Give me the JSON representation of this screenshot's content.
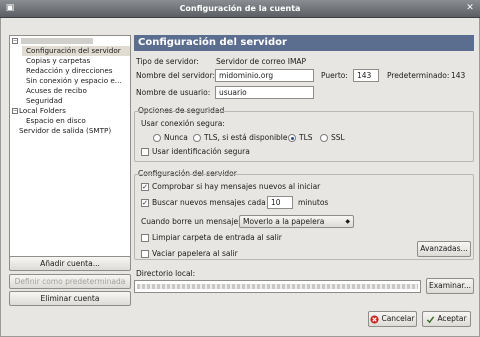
{
  "window": {
    "title": "Configuración de la cuenta"
  },
  "tree": {
    "account_blurred": true,
    "items": [
      "Configuración del servidor",
      "Copias y carpetas",
      "Redacción y direcciones",
      "Sin conexión y espacio e...",
      "Acuses de recibo",
      "Seguridad"
    ],
    "local_folders": "Local Folders",
    "disk_space": "Espacio en disco",
    "smtp": "Servidor de salida (SMTP)"
  },
  "left_buttons": {
    "add_account": "Añadir cuenta...",
    "set_default": "Definir como predeterminada",
    "delete_account": "Eliminar cuenta"
  },
  "panel": {
    "header": "Configuración del servidor",
    "server_type_label": "Tipo de servidor:",
    "server_type_value": "Servidor de correo IMAP",
    "server_name_label": "Nombre del servidor:",
    "server_name_value": "midominio.org",
    "port_label": "Puerto:",
    "port_value": "143",
    "default_label": "Predeterminado:",
    "default_value": "143",
    "username_label": "Nombre de usuario:",
    "username_value": "usuario"
  },
  "security": {
    "legend": "Opciones de seguridad",
    "secure_conn_label": "Usar conexión segura:",
    "options": [
      "Nunca",
      "TLS, si está disponible",
      "TLS",
      "SSL"
    ],
    "selected": "TLS",
    "secure_auth": "Usar identificación segura",
    "secure_auth_checked": false
  },
  "server_settings": {
    "legend": "Configuración del servidor",
    "check_on_start": "Comprobar si hay mensajes nuevos al iniciar",
    "check_on_start_checked": true,
    "check_every": "Buscar nuevos mensajes cada",
    "check_every_checked": true,
    "minutes_value": "10",
    "minutes_label": "minutos",
    "on_delete_label": "Cuando borre un mensaje:",
    "on_delete_value": "Moverlo a la papelera",
    "clean_inbox": "Limpiar carpeta de entrada al salir",
    "clean_inbox_checked": false,
    "empty_trash": "Vaciar papelera al salir",
    "empty_trash_checked": false,
    "advanced_button": "Avanzadas..."
  },
  "local_dir": {
    "label": "Directorio local:",
    "browse_button": "Examinar..."
  },
  "footer": {
    "cancel": "Cancelar",
    "accept": "Aceptar"
  },
  "colors": {
    "header_bg": "#5c6e90",
    "selected_row": "#e1dcd2"
  }
}
